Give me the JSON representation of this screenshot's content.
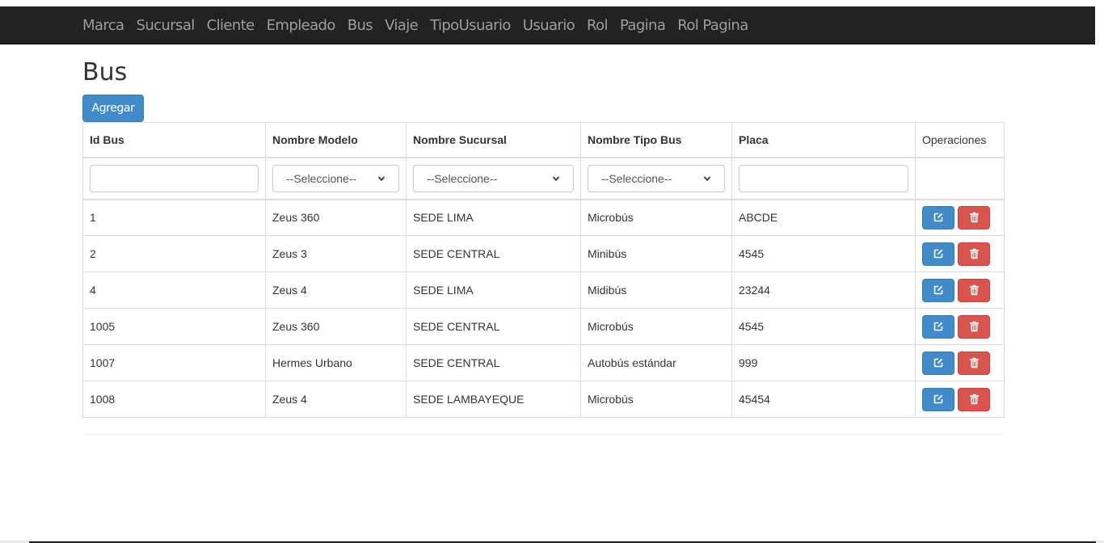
{
  "nav": {
    "items": [
      "Marca",
      "Sucursal",
      "Cliente",
      "Empleado",
      "Bus",
      "Viaje",
      "TipoUsuario",
      "Usuario",
      "Rol",
      "Pagina",
      "Rol Pagina"
    ]
  },
  "page": {
    "title": "Bus",
    "add_label": "Agregar"
  },
  "table": {
    "headers": [
      "Id Bus",
      "Nombre Modelo",
      "Nombre Sucursal",
      "Nombre Tipo Bus",
      "Placa",
      "Operaciones"
    ],
    "filters": {
      "id_value": "",
      "modelo_selected": "--Seleccione--",
      "sucursal_selected": "--Seleccione--",
      "tipo_selected": "--Seleccione--",
      "placa_value": ""
    },
    "rows": [
      [
        "1",
        "Zeus 360",
        "SEDE LIMA",
        "Microbús",
        "ABCDE"
      ],
      [
        "2",
        "Zeus 3",
        "SEDE CENTRAL",
        "Minibús",
        "4545"
      ],
      [
        "4",
        "Zeus 4",
        "SEDE LIMA",
        "Midibús",
        "23244"
      ],
      [
        "1005",
        "Zeus 360",
        "SEDE CENTRAL",
        "Microbús",
        "4545"
      ],
      [
        "1007",
        "Hermes Urbano",
        "SEDE CENTRAL",
        "Autobús estándar",
        "999"
      ],
      [
        "1008",
        "Zeus 4",
        "SEDE LAMBAYEQUE",
        "Microbús",
        "45454"
      ]
    ],
    "row_actions": {
      "edit_icon": "edit-icon",
      "delete_icon": "trash-icon"
    }
  },
  "colors": {
    "navbar": "#222222",
    "nav_text": "#9d9d9d",
    "primary": "#428bca",
    "danger": "#d9534f"
  }
}
